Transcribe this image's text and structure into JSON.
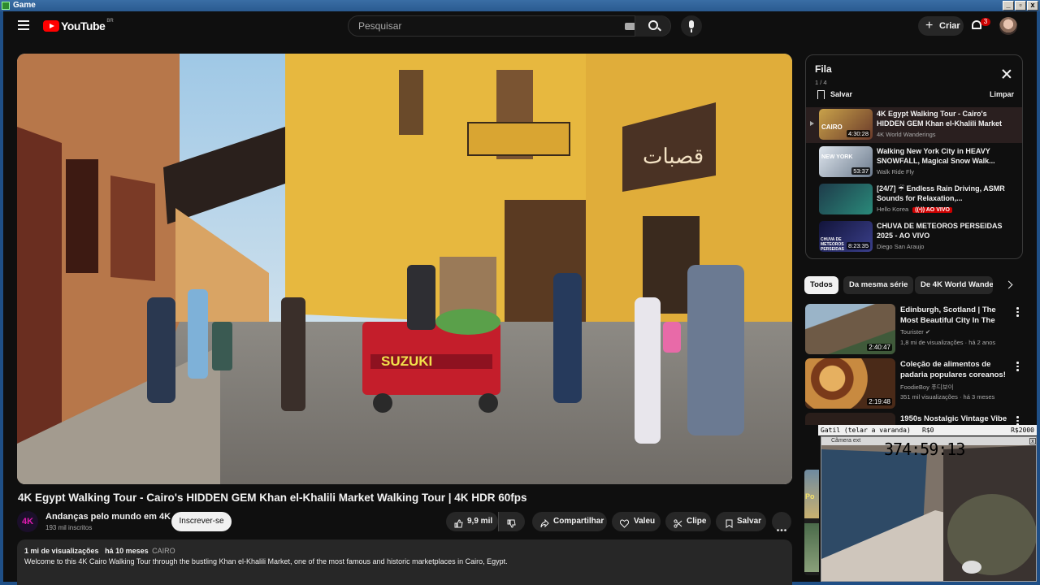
{
  "window": {
    "title": "Game",
    "controls": [
      "_",
      "▫",
      "x"
    ]
  },
  "header": {
    "logo_text": "YouTube",
    "logo_country": "BR",
    "search_placeholder": "Pesquisar",
    "create_label": "Criar",
    "notifications_count": "3"
  },
  "video": {
    "title": "4K Egypt Walking Tour - Cairo's HIDDEN GEM Khan el-Khalili Market Walking Tour | 4K HDR 60fps",
    "channel_avatar": "4K",
    "channel_name": "Andanças pelo mundo em 4K",
    "subscribers": "193 mil inscritos",
    "subscribe_label": "Inscrever-se",
    "likes": "9,9 mil",
    "share_label": "Compartilhar",
    "thanks_label": "Valeu",
    "clip_label": "Clipe",
    "save_label": "Salvar",
    "scene": {
      "truck_sign": "SUZUKI"
    }
  },
  "description": {
    "views": "1 mi de visualizações",
    "age": "há 10 meses",
    "tag": "CAIRO",
    "text": "Welcome to this 4K Cairo Walking Tour through the bustling Khan el-Khalili Market, one of the most famous and historic marketplaces in Cairo, Egypt."
  },
  "queue": {
    "title": "Fila",
    "count": "1 / 4",
    "save_label": "Salvar",
    "clear_label": "Limpar",
    "items": [
      {
        "title": "4K Egypt Walking Tour - Cairo's HIDDEN GEM Khan el-Khalili Market Walking...",
        "channel": "4K World Wanderings",
        "duration": "4:30:28",
        "thumb_text": "CAIRO"
      },
      {
        "title": "Walking New York City in HEAVY SNOWFALL, Magical Snow Walk...",
        "channel": "Walk Ride Fly",
        "duration": "53:37",
        "thumb_text": "NEW YORK"
      },
      {
        "title": "[24/7] ☔ Endless Rain Driving, ASMR Sounds for Relaxation,...",
        "channel": "Hello Korea",
        "live_label": "((•)) AO VIVO"
      },
      {
        "title": "CHUVA DE METEOROS PERSEIDAS 2025 - AO VIVO",
        "channel": "Diego San Araujo",
        "duration": "8:23:35",
        "thumb_text": "CHUVA DE METEOROS PERSEIDAS"
      }
    ]
  },
  "chips": [
    "Todos",
    "Da mesma série",
    "De 4K World Wanderings"
  ],
  "recommendations": [
    {
      "title": "Edinburgh, Scotland | The Most Beautiful City In The World | ...",
      "channel": "Tourister",
      "meta": "1,8 mi de visualizações · há 2 anos",
      "duration": "2:40:47",
      "verified": "✔"
    },
    {
      "title": "Coleção de alimentos de padaria populares coreanos!",
      "channel": "FoodieBoy 푸디보이",
      "meta": "351 mil visualizações · há 3 meses",
      "duration": "2:19:48"
    },
    {
      "title": "1950s Nostalgic Vintage Vibe",
      "channel": "",
      "meta": "",
      "duration": ""
    }
  ],
  "overlay": {
    "bar_label": "Gatil (telar a varanda)",
    "bar_mid": "R$0",
    "bar_right": "R$2000",
    "cam_title": "Câmera ext",
    "timer": "374:59:13",
    "side_text": "Po"
  },
  "colors": {
    "bg": "#0f0f0f",
    "accent": "#ff0000",
    "live": "#cc0000",
    "chip_bg": "#272727"
  }
}
